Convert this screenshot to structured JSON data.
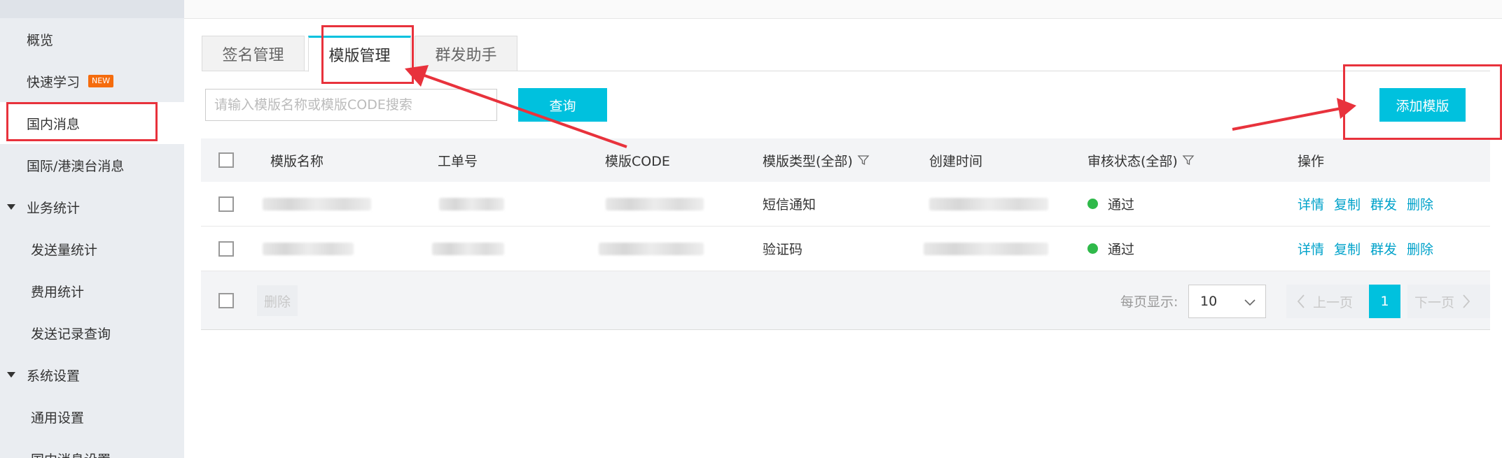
{
  "sidebar": {
    "items": [
      {
        "label": "概览"
      },
      {
        "label": "快速学习",
        "badge": "NEW"
      },
      {
        "label": "国内消息"
      },
      {
        "label": "国际/港澳台消息"
      },
      {
        "label": "业务统计"
      },
      {
        "label": "发送量统计"
      },
      {
        "label": "费用统计"
      },
      {
        "label": "发送记录查询"
      },
      {
        "label": "系统设置"
      },
      {
        "label": "通用设置"
      },
      {
        "label": "国内消息设置"
      }
    ]
  },
  "tabs": [
    {
      "label": "签名管理"
    },
    {
      "label": "模版管理"
    },
    {
      "label": "群发助手"
    }
  ],
  "search": {
    "placeholder": "请输入模版名称或模版CODE搜索",
    "button": "查询"
  },
  "add_button": "添加模版",
  "table": {
    "headers": {
      "name": "模版名称",
      "ticket": "工单号",
      "code": "模版CODE",
      "type": "模版类型(全部)",
      "created": "创建时间",
      "status": "审核状态(全部)",
      "actions": "操作"
    },
    "rows": [
      {
        "type": "短信通知",
        "status": "通过",
        "actions": [
          "详情",
          "复制",
          "群发",
          "删除"
        ]
      },
      {
        "type": "验证码",
        "status": "通过",
        "actions": [
          "详情",
          "复制",
          "群发",
          "删除"
        ]
      }
    ]
  },
  "footer": {
    "delete": "删除",
    "per_page_label": "每页显示:",
    "per_page_value": "10",
    "prev": "上一页",
    "current_page": "1",
    "next": "下一页"
  },
  "colors": {
    "accent": "#00c1de",
    "link": "#00a2ca",
    "status_ok": "#2fb94a",
    "annotation": "#e8323c",
    "badge": "#f56c0e"
  },
  "icons": [
    "filter-icon",
    "chevron-down-icon",
    "chevron-left-icon",
    "chevron-right-icon",
    "caret-down-icon"
  ]
}
